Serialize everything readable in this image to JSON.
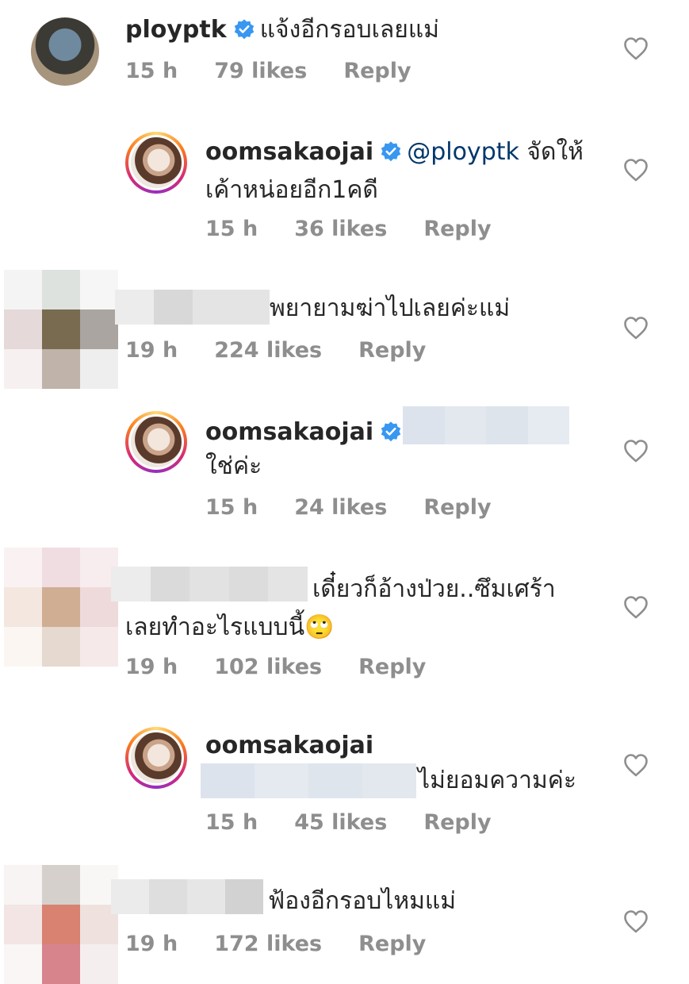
{
  "comments": [
    {
      "username": "ployptk",
      "verified": true,
      "text": "แจ้งอีกรอบเลยแม่",
      "time": "15 h",
      "likes": "79 likes",
      "reply": "Reply"
    },
    {
      "username": "oomsakaojai",
      "verified": true,
      "mention": "@ployptk",
      "text": "จัดให้",
      "text2": "เค้าหน่อยอีก1คดี",
      "time": "15 h",
      "likes": "36 likes",
      "reply": "Reply"
    },
    {
      "text": "พยายามฆ่าไปเลยค่ะแม่",
      "time": "19 h",
      "likes": "224 likes",
      "reply": "Reply"
    },
    {
      "username": "oomsakaojai",
      "verified": true,
      "text2": "ใช่ค่ะ",
      "time": "15 h",
      "likes": "24 likes",
      "reply": "Reply"
    },
    {
      "text": "เดี๋ยวก็อ้างป่วย..ซึมเศร้า",
      "text2": "เลยทำอะไรแบบนี้🙄",
      "time": "19 h",
      "likes": "102 likes",
      "reply": "Reply"
    },
    {
      "username": "oomsakaojai",
      "text": "ไม่ยอมความค่ะ",
      "time": "15 h",
      "likes": "45 likes",
      "reply": "Reply"
    },
    {
      "text": "ฟ้องอีกรอบไหมแม่",
      "time": "19 h",
      "likes": "172 likes",
      "reply": "Reply"
    }
  ],
  "colors": {
    "text": "#262626",
    "meta": "#8e8e8e",
    "mention": "#00376b",
    "verified": "#3897f0",
    "heart": "#8e8e8e"
  },
  "icons": [
    "verified-badge-icon",
    "heart-icon"
  ]
}
